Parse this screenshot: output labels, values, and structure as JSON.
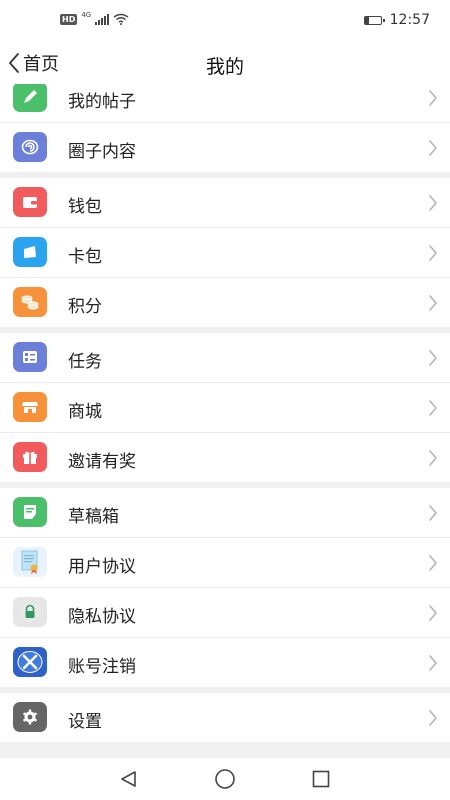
{
  "status_bar": {
    "hd": "HD",
    "network": "4G",
    "time": "12:57",
    "battery_level": 0.25
  },
  "header": {
    "back_label": "首页",
    "title": "我的"
  },
  "groups": [
    {
      "items": [
        {
          "label": "我的帖子",
          "icon": "post-icon",
          "color": "#4cbf6b"
        },
        {
          "label": "圈子内容",
          "icon": "circle-content-icon",
          "color": "#6c7fd9"
        }
      ]
    },
    {
      "items": [
        {
          "label": "钱包",
          "icon": "wallet-icon",
          "color": "#f25b5b"
        },
        {
          "label": "卡包",
          "icon": "card-holder-icon",
          "color": "#2aa4ef"
        },
        {
          "label": "积分",
          "icon": "points-icon",
          "color": "#f7923a"
        }
      ]
    },
    {
      "items": [
        {
          "label": "任务",
          "icon": "task-icon",
          "color": "#6c7fd9"
        },
        {
          "label": "商城",
          "icon": "store-icon",
          "color": "#f7923a"
        },
        {
          "label": "邀请有奖",
          "icon": "gift-icon",
          "color": "#f25b5b"
        }
      ]
    },
    {
      "items": [
        {
          "label": "草稿箱",
          "icon": "drafts-icon",
          "color": "#4cbf6b"
        },
        {
          "label": "用户协议",
          "icon": "user-agreement-icon",
          "color": "#e8f3ff"
        },
        {
          "label": "隐私协议",
          "icon": "privacy-lock-icon",
          "color": "#e6e6e6"
        },
        {
          "label": "账号注销",
          "icon": "account-cancel-icon",
          "color": "#2f62c8"
        }
      ]
    },
    {
      "items": [
        {
          "label": "设置",
          "icon": "gear-icon",
          "color": "#666666"
        }
      ]
    }
  ]
}
